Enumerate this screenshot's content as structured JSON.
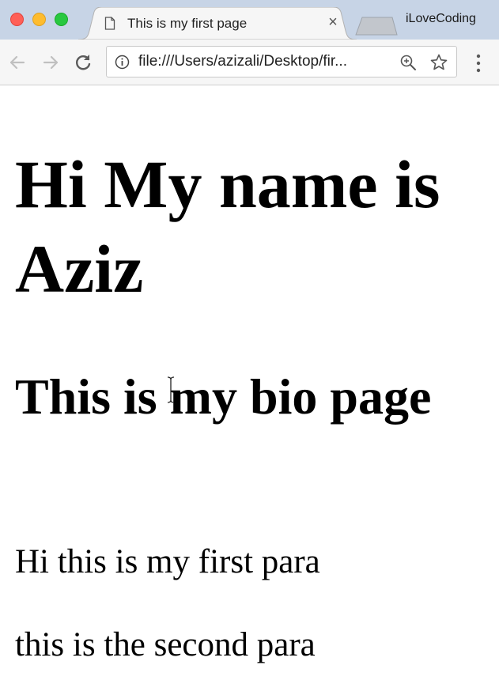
{
  "tab": {
    "title": "This is my first page",
    "close_glyph": "×"
  },
  "profile": {
    "name": "iLoveCoding"
  },
  "omnibox": {
    "url": "file:///Users/azizali/Desktop/fir..."
  },
  "icons": {
    "tab_page": "document-icon",
    "back": "back-arrow-icon",
    "forward": "forward-arrow-icon",
    "reload": "reload-icon",
    "info": "info-icon",
    "zoom": "zoom-icon",
    "bookmark": "star-icon",
    "menu": "kebab-menu-icon"
  },
  "page": {
    "heading1": "Hi My name is Aziz",
    "heading2": "This is my bio page",
    "paragraphs": [
      "Hi this is my first para",
      "this is the second para"
    ]
  },
  "colors": {
    "tabstrip": "#c7d4e6",
    "toolbar": "#f6f6f6",
    "close_button": "#ff5f57",
    "minimize_button": "#febc2e",
    "zoom_button": "#28c840"
  }
}
